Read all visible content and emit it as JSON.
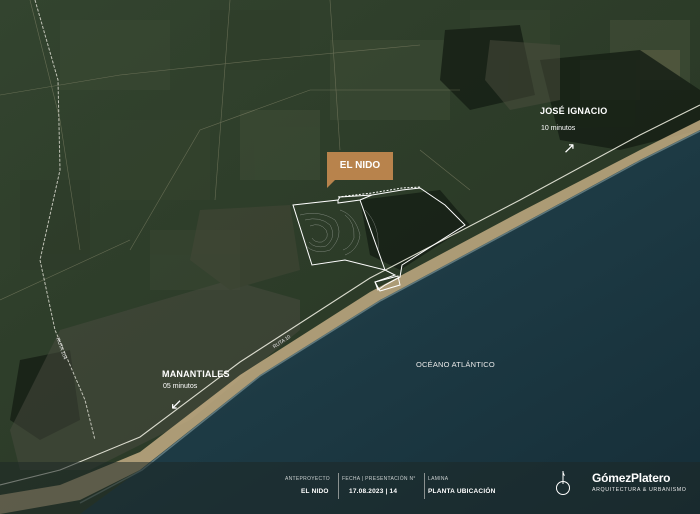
{
  "map": {
    "project_label": "EL NIDO",
    "places": {
      "jose_ignacio": {
        "name": "JOSÉ IGNACIO",
        "time": "10 minutos",
        "arrow": "↗"
      },
      "manantiales": {
        "name": "MANANTIALES",
        "time": "05 minutos",
        "arrow": "↙"
      }
    },
    "roads": {
      "ruta_104": "RUTA 104",
      "ruta_10": "RUTA 10"
    },
    "ocean": "OCÉANO ATLÁNTICO",
    "colors": {
      "callout": "#b8834c",
      "ocean": "#1d3a44",
      "land": "#2c3b28",
      "beach": "#cdb48a"
    }
  },
  "footer": {
    "anteproyecto": {
      "head": "ANTEPROYECTO",
      "value": "EL NIDO"
    },
    "fecha": {
      "head": "FECHA | PRESENTACIÓN N°",
      "value": "17.08.2023 | 14"
    },
    "lamina": {
      "head": "LAMINA",
      "value": "PLANTA UBICACIÓN"
    },
    "north_icon": "north-arrow",
    "brand": "GómezPlatero",
    "tagline": "ARQUITECTURA & URBANISMO"
  }
}
